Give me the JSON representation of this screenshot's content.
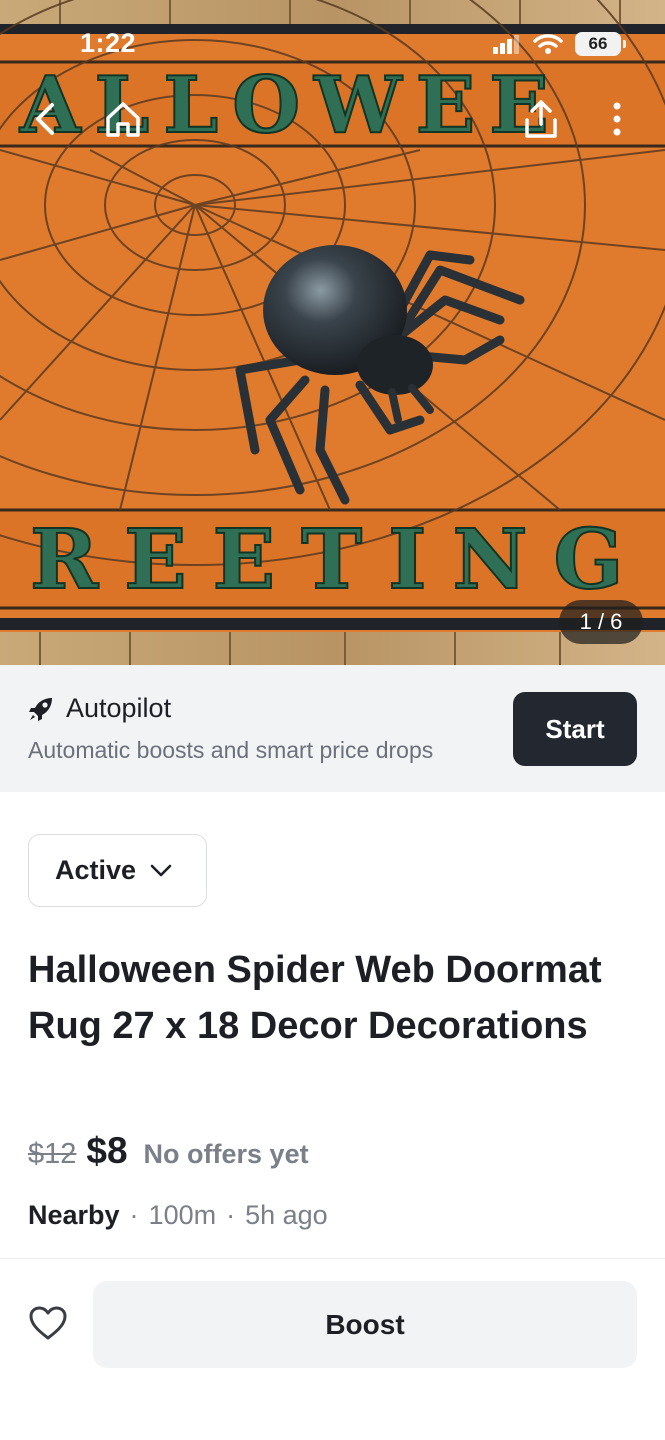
{
  "status_bar": {
    "time": "1:22",
    "battery": "66"
  },
  "hero": {
    "image_alt": "Halloween spider web doormat photo",
    "rug_top_text": "ALLOWEE",
    "rug_bottom_text": "REETING",
    "counter": "1 / 6"
  },
  "nav": {
    "back_icon": "chevron-left-icon",
    "home_icon": "home-icon",
    "share_icon": "share-icon",
    "more_icon": "more-vertical-icon"
  },
  "autopilot": {
    "icon": "rocket-icon",
    "title": "Autopilot",
    "subtitle": "Automatic boosts and smart price drops",
    "start_label": "Start"
  },
  "listing": {
    "status": "Active",
    "title": "Halloween Spider Web Doormat Rug 27 x 18 Decor Decorations",
    "original_price": "$12",
    "price": "$8",
    "offers": "No offers yet",
    "location": "Nearby",
    "distance": "100m",
    "posted": "5h ago",
    "separator": "·"
  },
  "bottom_bar": {
    "favorite_icon": "heart-outline-icon",
    "boost_label": "Boost"
  },
  "colors": {
    "rug_orange": "#e07a2c",
    "rug_text_green": "#2f6f55",
    "dark_button": "#23272f",
    "muted_text": "#7b7f88"
  }
}
